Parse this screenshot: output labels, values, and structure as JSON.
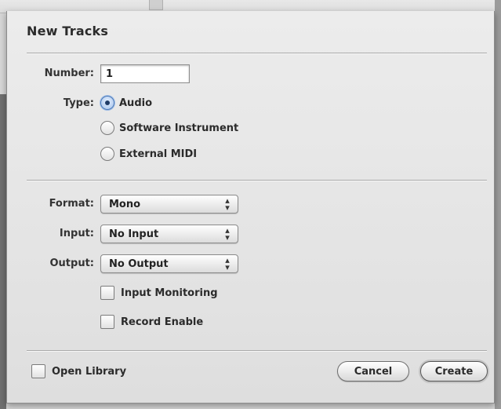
{
  "dialog": {
    "title": "New Tracks",
    "number_label": "Number:",
    "number_value": "1",
    "type_label": "Type:",
    "type_options": [
      {
        "label": "Audio",
        "selected": true
      },
      {
        "label": "Software Instrument",
        "selected": false
      },
      {
        "label": "External MIDI",
        "selected": false
      }
    ],
    "format_label": "Format:",
    "format_value": "Mono",
    "input_label": "Input:",
    "input_value": "No Input",
    "output_label": "Output:",
    "output_value": "No Output",
    "input_monitoring_label": "Input Monitoring",
    "input_monitoring_checked": false,
    "record_enable_label": "Record Enable",
    "record_enable_checked": false,
    "open_library_label": "Open Library",
    "open_library_checked": false,
    "cancel_label": "Cancel",
    "create_label": "Create",
    "popup_arrows_icon": "updown-arrows-icon",
    "accent_color": "#4a78b8"
  }
}
